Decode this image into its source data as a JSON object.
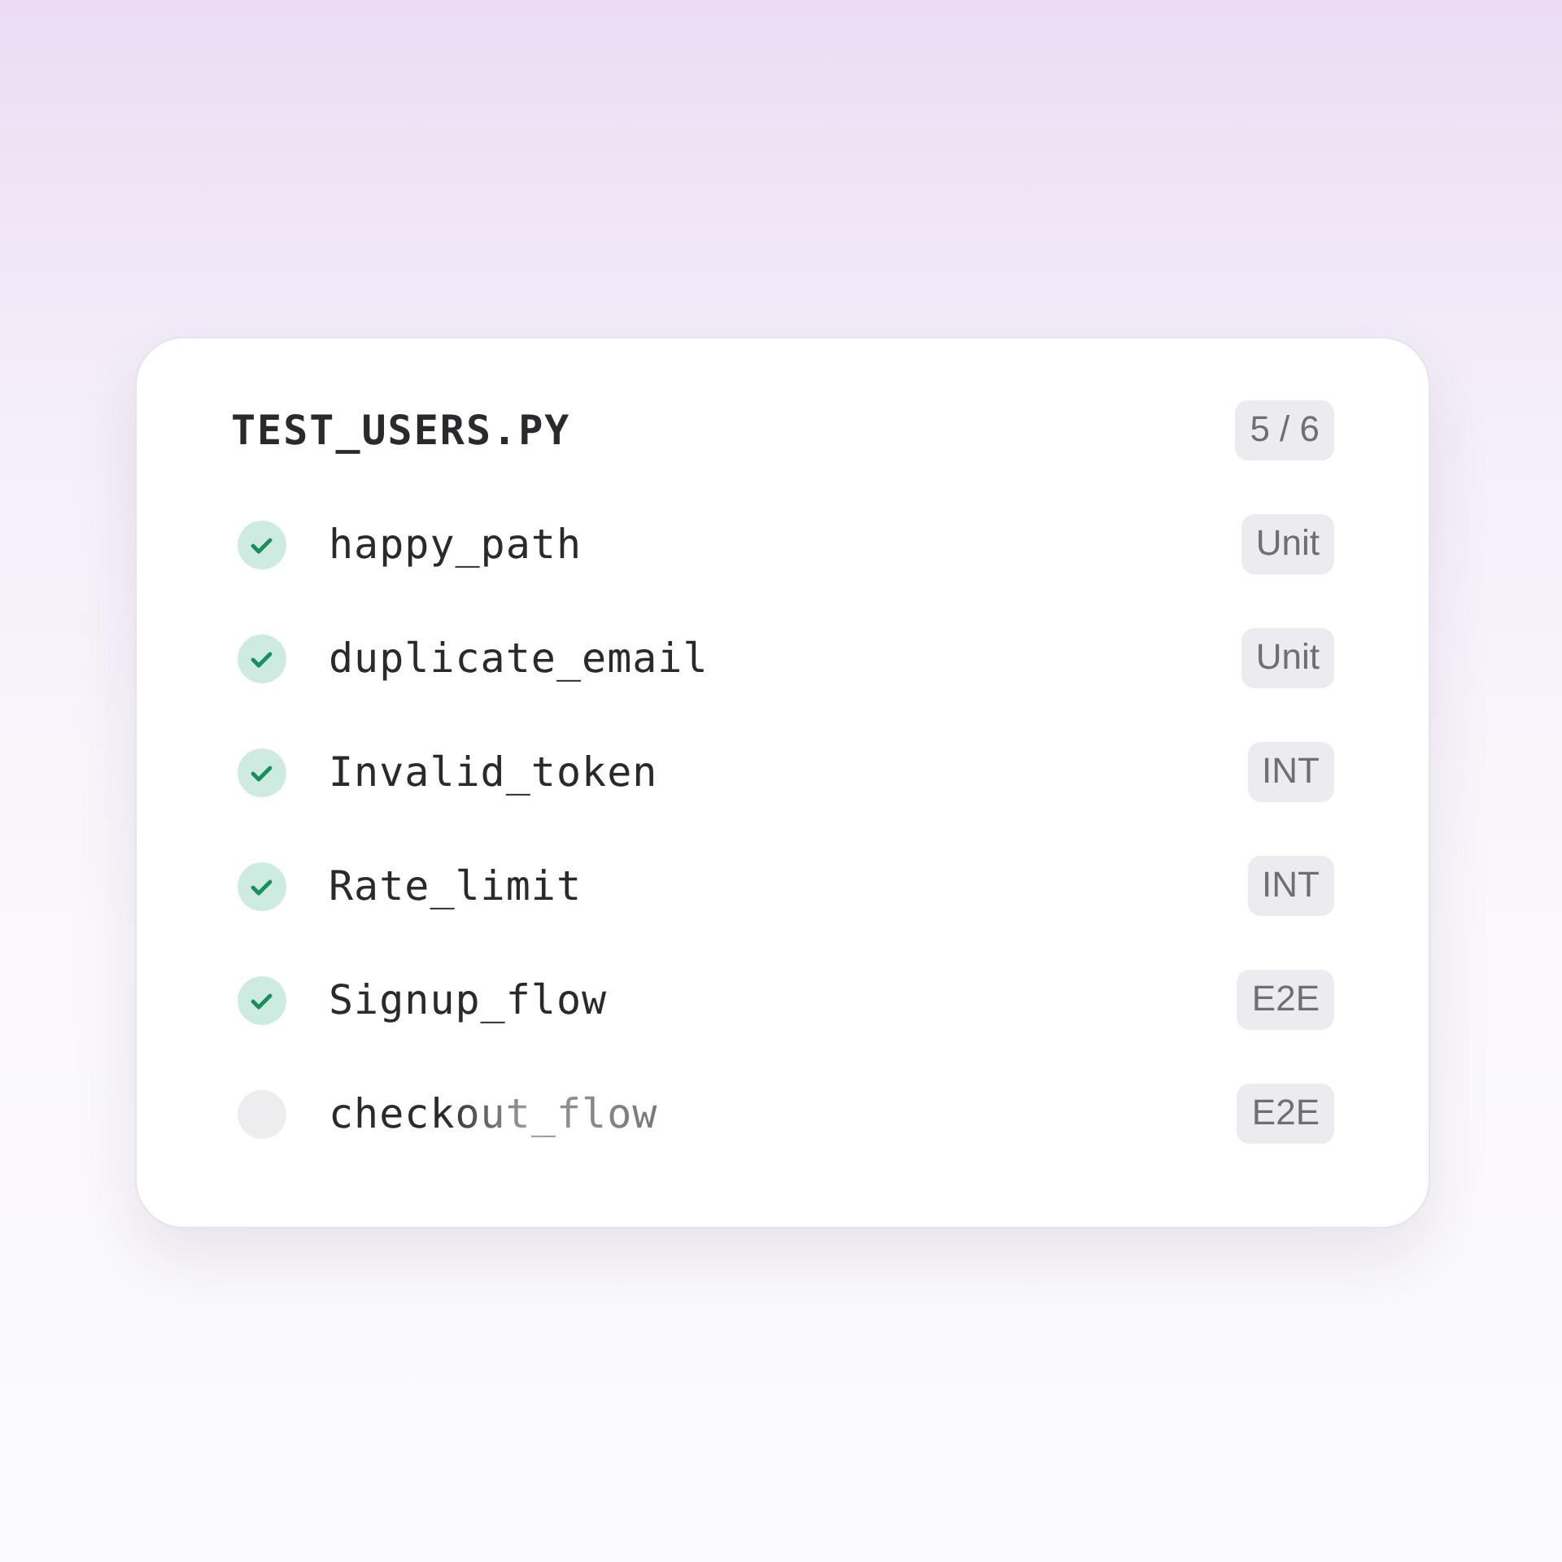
{
  "file": {
    "title": "TEST_USERS.PY",
    "count": "5 / 6"
  },
  "tests": [
    {
      "name": "happy_path",
      "passed": true,
      "tag": "Unit"
    },
    {
      "name": "duplicate_email",
      "passed": true,
      "tag": "Unit"
    },
    {
      "name": "Invalid_token",
      "passed": true,
      "tag": "INT"
    },
    {
      "name": "Rate_limit",
      "passed": true,
      "tag": "INT"
    },
    {
      "name": "Signup_flow",
      "passed": true,
      "tag": "E2E"
    },
    {
      "name": "checkout_flow",
      "passed": false,
      "tag": "E2E"
    }
  ]
}
